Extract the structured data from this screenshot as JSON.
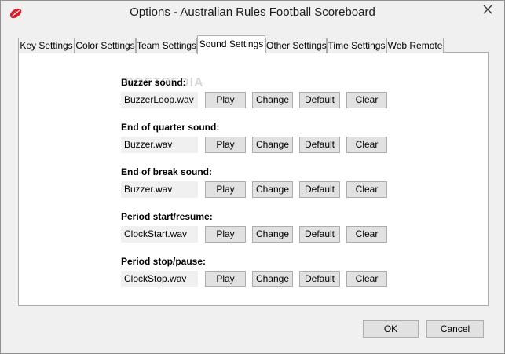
{
  "window": {
    "title": "Options - Australian Rules Football Scoreboard"
  },
  "tabs": [
    {
      "label": "Key Settings",
      "active": false
    },
    {
      "label": "Color Settings",
      "active": false
    },
    {
      "label": "Team Settings",
      "active": false
    },
    {
      "label": "Sound Settings",
      "active": true
    },
    {
      "label": "Other Settings",
      "active": false
    },
    {
      "label": "Time Settings",
      "active": false
    },
    {
      "label": "Web Remote",
      "active": false
    }
  ],
  "sounds": [
    {
      "label": "Buzzer sound:",
      "file": "BuzzerLoop.wav"
    },
    {
      "label": "End of quarter sound:",
      "file": "Buzzer.wav"
    },
    {
      "label": "End of break sound:",
      "file": "Buzzer.wav"
    },
    {
      "label": "Period start/resume:",
      "file": "ClockStart.wav"
    },
    {
      "label": "Period stop/pause:",
      "file": "ClockStop.wav"
    }
  ],
  "row_buttons": {
    "play": "Play",
    "change": "Change",
    "default": "Default",
    "clear": "Clear"
  },
  "dialog": {
    "ok": "OK",
    "cancel": "Cancel"
  },
  "colors": {
    "logo": "#d4202a",
    "window_bg": "#f0f0f0",
    "button_bg": "#e1e1e1"
  }
}
